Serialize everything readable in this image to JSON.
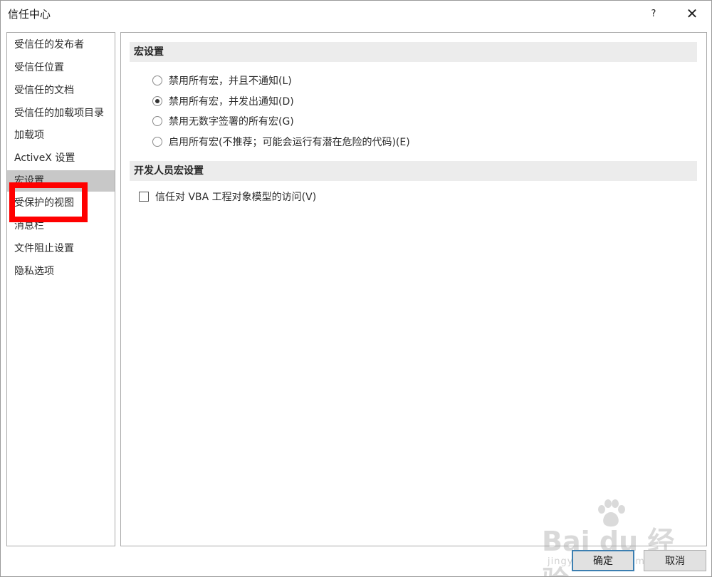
{
  "window": {
    "title": "信任中心",
    "help_label": "?",
    "close_label": "✕"
  },
  "sidebar": {
    "items": [
      {
        "label": "受信任的发布者"
      },
      {
        "label": "受信任位置"
      },
      {
        "label": "受信任的文档"
      },
      {
        "label": "受信任的加载项目录"
      },
      {
        "label": "加载项"
      },
      {
        "label": "ActiveX 设置"
      },
      {
        "label": "宏设置",
        "selected": true
      },
      {
        "label": "受保护的视图"
      },
      {
        "label": "消息栏"
      },
      {
        "label": "文件阻止设置"
      },
      {
        "label": "隐私选项"
      }
    ]
  },
  "main": {
    "macro_section": {
      "title": "宏设置",
      "options": [
        {
          "label": "禁用所有宏，并且不通知(L)",
          "checked": false
        },
        {
          "label": "禁用所有宏，并发出通知(D)",
          "checked": true
        },
        {
          "label": "禁用无数字签署的所有宏(G)",
          "checked": false
        },
        {
          "label": "启用所有宏(不推荐；可能会运行有潜在危险的代码)(E)",
          "checked": false
        }
      ]
    },
    "developer_section": {
      "title": "开发人员宏设置",
      "checkbox_label": "信任对 VBA 工程对象模型的访问(V)",
      "checked": false
    }
  },
  "footer": {
    "ok_label": "确定",
    "cancel_label": "取消"
  },
  "watermark": {
    "logo": "Bai du 经验",
    "sub": "jingyan.baidu.com"
  },
  "colors": {
    "highlight": "#ff0000",
    "selected_bg": "#c8c8c8",
    "section_bg": "#ececec",
    "primary_border": "#3c7fb1"
  }
}
